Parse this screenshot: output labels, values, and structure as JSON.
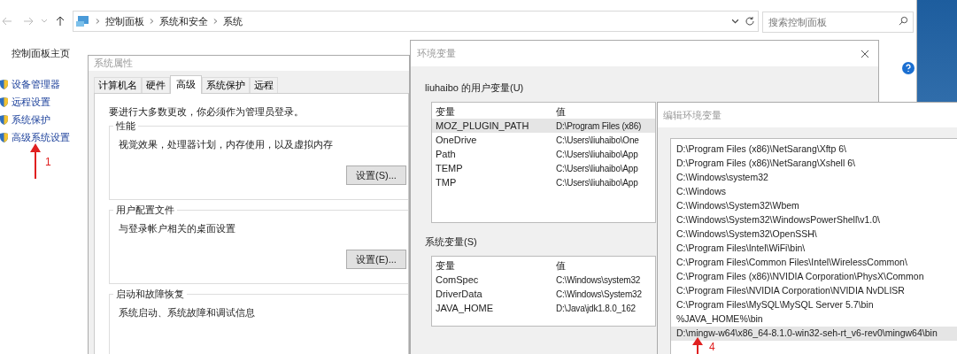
{
  "explorer": {
    "breadcrumb": [
      "控制面板",
      "系统和安全",
      "系统"
    ],
    "search": {
      "placeholder": "搜索控制面板"
    },
    "sidebar": {
      "home": "控制面板主页",
      "items": [
        {
          "label": "设备管理器"
        },
        {
          "label": "远程设置"
        },
        {
          "label": "系统保护"
        },
        {
          "label": "高级系统设置"
        }
      ]
    }
  },
  "system_properties": {
    "title": "系统属性",
    "tabs": [
      {
        "label": "计算机名",
        "selected": false
      },
      {
        "label": "硬件",
        "selected": false
      },
      {
        "label": "高级",
        "selected": true
      },
      {
        "label": "系统保护",
        "selected": false
      },
      {
        "label": "远程",
        "selected": false
      }
    ],
    "notice": "要进行大多数更改，你必须作为管理员登录。",
    "sections": [
      {
        "title": "性能",
        "description": "视觉效果，处理器计划，内存使用，以及虚拟内存",
        "button": "设置(S)..."
      },
      {
        "title": "用户配置文件",
        "description": "与登录帐户相关的桌面设置",
        "button": "设置(E)..."
      },
      {
        "title": "启动和故障恢复",
        "description": "系统启动、系统故障和调试信息"
      }
    ]
  },
  "environment_variables": {
    "title": "环境变量",
    "user_variables": {
      "title": "liuhaibo 的用户变量(U)",
      "columns": [
        "变量",
        "值"
      ],
      "rows": [
        {
          "name": "MOZ_PLUGIN_PATH",
          "value": "D:\\Program Files (x86)",
          "selected": true
        },
        {
          "name": "OneDrive",
          "value": "C:\\Users\\liuhaibo\\One",
          "selected": false
        },
        {
          "name": "Path",
          "value": "C:\\Users\\liuhaibo\\App",
          "selected": false
        },
        {
          "name": "TEMP",
          "value": "C:\\Users\\liuhaibo\\App",
          "selected": false
        },
        {
          "name": "TMP",
          "value": "C:\\Users\\liuhaibo\\App",
          "selected": false
        }
      ]
    },
    "system_variables": {
      "title": "系统变量(S)",
      "columns": [
        "变量",
        "值"
      ],
      "rows": [
        {
          "name": "ComSpec",
          "value": "C:\\Windows\\system32",
          "selected": false
        },
        {
          "name": "DriverData",
          "value": "C:\\Windows\\System32",
          "selected": false
        },
        {
          "name": "JAVA_HOME",
          "value": "D:\\Java\\jdk1.8.0_162",
          "selected": false
        }
      ]
    }
  },
  "edit_environment_variable": {
    "title": "编辑环境变量",
    "entries": [
      {
        "text": "D:\\Program Files (x86)\\NetSarang\\Xftp 6\\",
        "selected": false
      },
      {
        "text": "D:\\Program Files (x86)\\NetSarang\\Xshell 6\\",
        "selected": false
      },
      {
        "text": "C:\\Windows\\system32",
        "selected": false
      },
      {
        "text": "C:\\Windows",
        "selected": false
      },
      {
        "text": "C:\\Windows\\System32\\Wbem",
        "selected": false
      },
      {
        "text": "C:\\Windows\\System32\\WindowsPowerShell\\v1.0\\",
        "selected": false
      },
      {
        "text": "C:\\Windows\\System32\\OpenSSH\\",
        "selected": false
      },
      {
        "text": "C:\\Program Files\\Intel\\WiFi\\bin\\",
        "selected": false
      },
      {
        "text": "C:\\Program Files\\Common Files\\Intel\\WirelessCommon\\",
        "selected": false
      },
      {
        "text": "C:\\Program Files (x86)\\NVIDIA Corporation\\PhysX\\Common",
        "selected": false
      },
      {
        "text": "C:\\Program Files\\NVIDIA Corporation\\NVIDIA NvDLISR",
        "selected": false
      },
      {
        "text": "C:\\Program Files\\MySQL\\MySQL Server 5.7\\bin",
        "selected": false
      },
      {
        "text": "%JAVA_HOME%\\bin",
        "selected": false
      },
      {
        "text": "D:\\mingw-w64\\x86_64-8.1.0-win32-seh-rt_v6-rev0\\mingw64\\bin",
        "selected": true
      }
    ]
  },
  "annotations": [
    {
      "label": "1"
    },
    {
      "label": "4"
    }
  ]
}
